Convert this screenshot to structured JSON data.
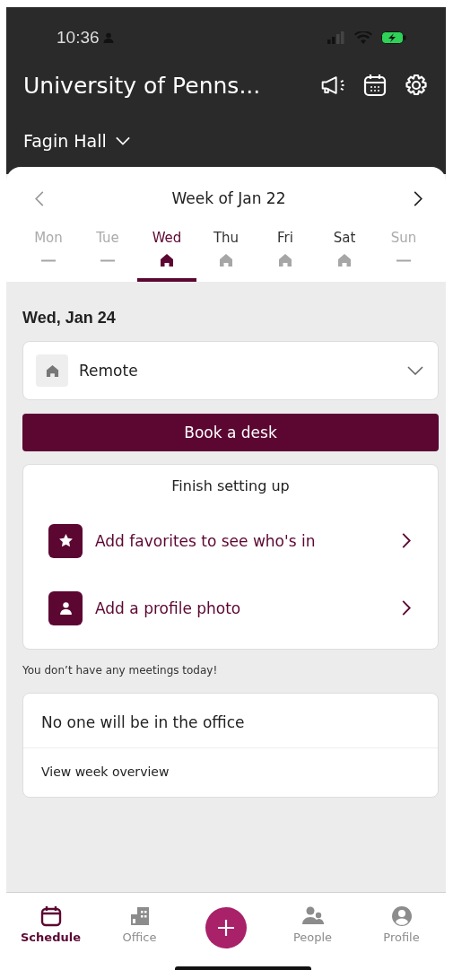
{
  "status_bar": {
    "time": "10:36"
  },
  "header": {
    "title": "University of Penns...",
    "location": "Fagin Hall"
  },
  "week": {
    "title": "Week of Jan 22",
    "days": [
      {
        "label": "Mon",
        "selected": false,
        "disabled": true,
        "kind": "none"
      },
      {
        "label": "Tue",
        "selected": false,
        "disabled": true,
        "kind": "none"
      },
      {
        "label": "Wed",
        "selected": true,
        "disabled": false,
        "kind": "home"
      },
      {
        "label": "Thu",
        "selected": false,
        "disabled": false,
        "kind": "home"
      },
      {
        "label": "Fri",
        "selected": false,
        "disabled": false,
        "kind": "home"
      },
      {
        "label": "Sat",
        "selected": false,
        "disabled": false,
        "kind": "home"
      },
      {
        "label": "Sun",
        "selected": false,
        "disabled": true,
        "kind": "none"
      }
    ]
  },
  "day": {
    "date": "Wed, Jan 24",
    "work_mode": "Remote",
    "book_button": "Book a desk"
  },
  "setup": {
    "title": "Finish setting up",
    "items": [
      {
        "label": "Add favorites to see who's in",
        "kind": "star"
      },
      {
        "label": "Add a profile photo",
        "kind": "person"
      }
    ]
  },
  "meetings_note": "You don’t have any meetings today!",
  "office_card": {
    "title": "No one will be in the office",
    "link": "View week overview"
  },
  "bottom_nav": [
    {
      "label": "Schedule",
      "selected": true,
      "kind": "calendar"
    },
    {
      "label": "Office",
      "selected": false,
      "kind": "building"
    },
    {
      "kind": "add"
    },
    {
      "label": "People",
      "selected": false,
      "kind": "people"
    },
    {
      "label": "Profile",
      "selected": false,
      "kind": "profile"
    }
  ]
}
